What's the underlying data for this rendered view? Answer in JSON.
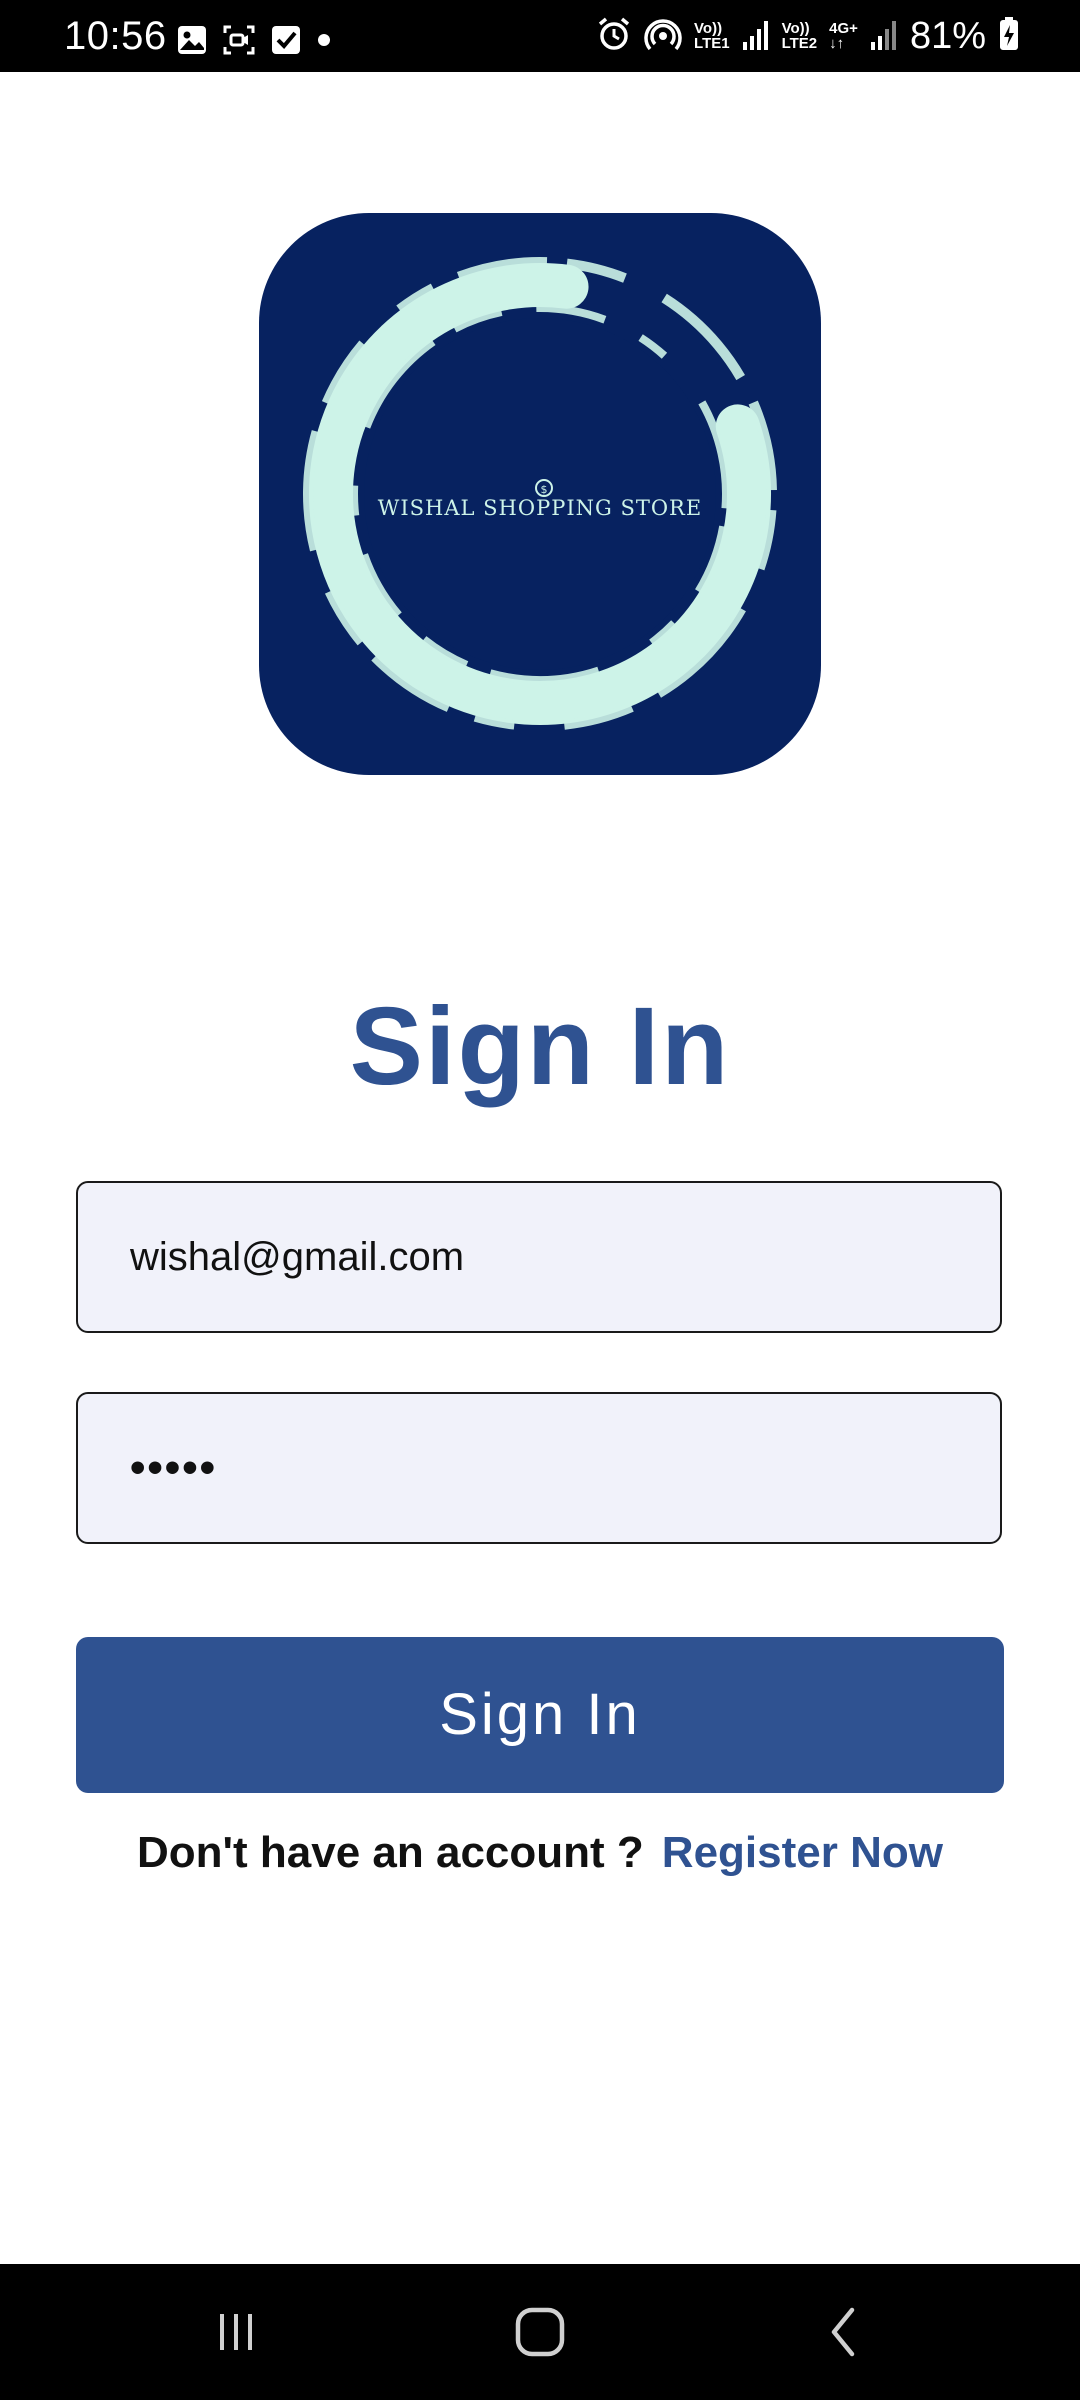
{
  "status_bar": {
    "time": "10:56",
    "left_icons": [
      "gallery-icon",
      "screen-record-icon",
      "task-check-icon",
      "dot-icon"
    ],
    "network_1": "Vo))\nLTE1",
    "network_2": "Vo))\nLTE2",
    "network_3": "4G+\n↓↑",
    "battery": "81%",
    "right_icons": [
      "alarm-icon",
      "hotspot-icon",
      "signal-icon",
      "signal-icon",
      "signal-icon",
      "battery-charging-icon"
    ]
  },
  "logo": {
    "text": "WISHAL SHOPPING STORE",
    "coin_symbol": "$",
    "background_color": "#072260",
    "ring_color": "#cdf3e8"
  },
  "title": "Sign In",
  "form": {
    "email_value": "wishal@gmail.com",
    "password_display": "•••••",
    "submit_label": "Sign In"
  },
  "register": {
    "prompt": "Don't have an account ?",
    "link": "Register Now"
  },
  "nav_bar": {
    "buttons": [
      "recent-apps-icon",
      "home-icon",
      "back-icon"
    ]
  },
  "colors": {
    "accent": "#2f5291",
    "input_bg": "#f1f2fa"
  }
}
